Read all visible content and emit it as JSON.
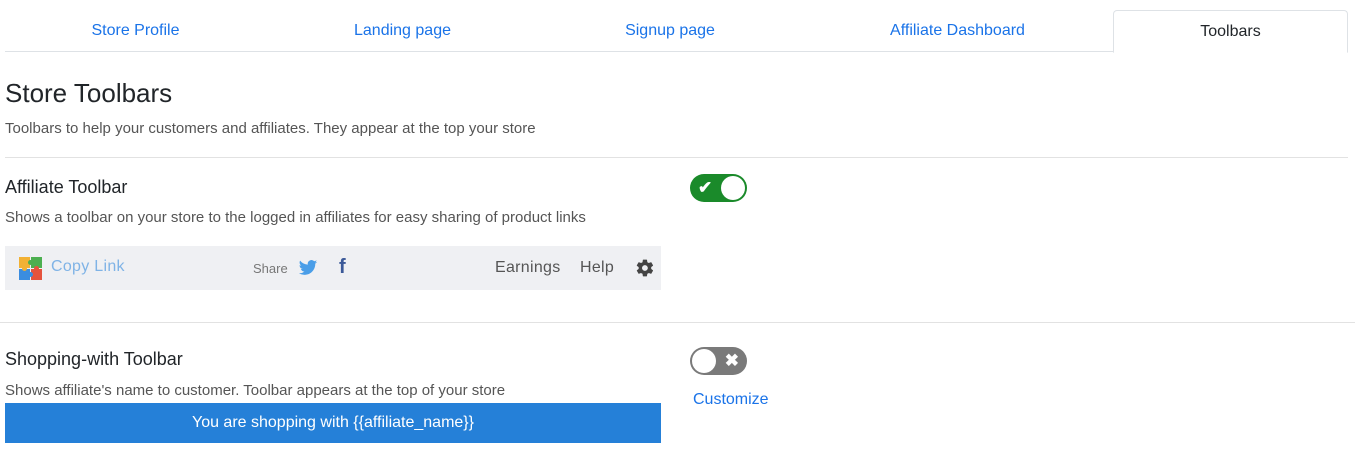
{
  "tabs": [
    {
      "label": "Store Profile"
    },
    {
      "label": "Landing page"
    },
    {
      "label": "Signup page"
    },
    {
      "label": "Affiliate Dashboard"
    },
    {
      "label": "Toolbars"
    }
  ],
  "active_tab": "Toolbars",
  "page": {
    "title": "Store Toolbars",
    "description": "Toolbars to help your customers and affiliates. They appear at the top your store"
  },
  "affiliate_toolbar": {
    "title": "Affiliate Toolbar",
    "description": "Shows a toolbar on your store to the logged in affiliates for easy sharing of product links",
    "enabled": true,
    "preview": {
      "copy_link": "Copy Link",
      "share": "Share",
      "earnings": "Earnings",
      "help": "Help",
      "icons": [
        "puzzle-logo-icon",
        "twitter-icon",
        "facebook-icon",
        "gear-icon"
      ]
    }
  },
  "shopping_toolbar": {
    "title": "Shopping-with Toolbar",
    "description": "Shows affiliate's name to customer. Toolbar appears at the top of your store",
    "enabled": false,
    "customize": "Customize",
    "bar_text": "You are shopping with {{affiliate_name}}"
  },
  "colors": {
    "link": "#1a73e8",
    "toggle_on": "#1a8a2a",
    "toggle_off": "#7a7a7a",
    "shopping_bar": "#2580d8",
    "toolbar_bg": "#eff0f3"
  }
}
